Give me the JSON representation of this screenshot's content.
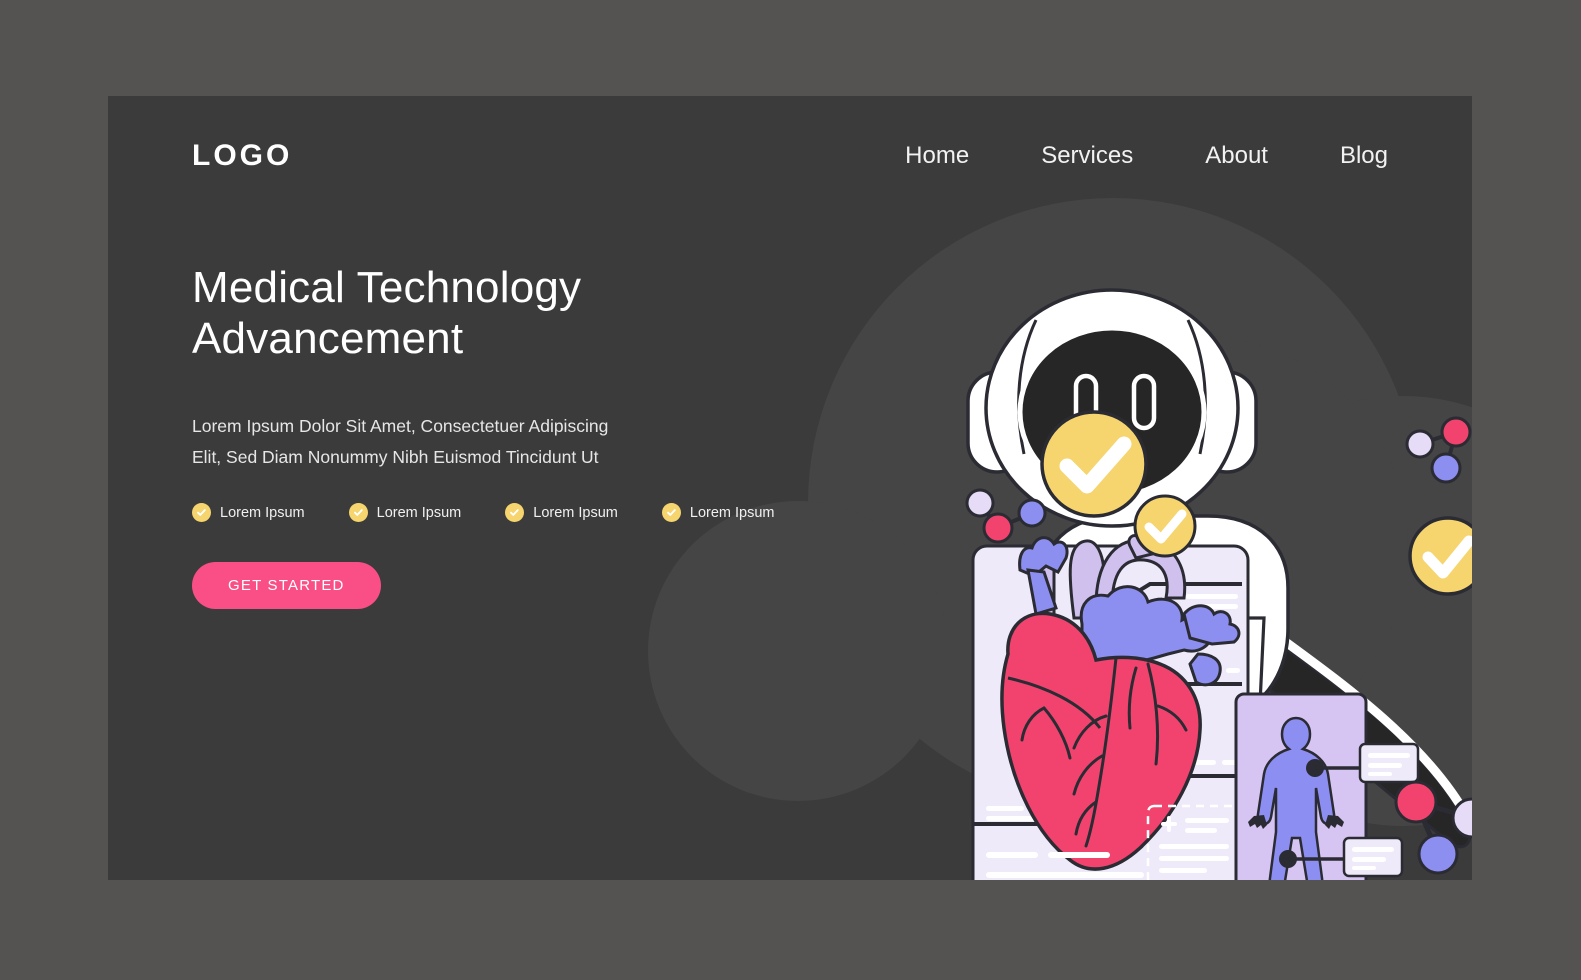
{
  "header": {
    "logo": "LOGO",
    "nav": [
      {
        "label": "Home"
      },
      {
        "label": "Services"
      },
      {
        "label": "About"
      },
      {
        "label": "Blog"
      }
    ]
  },
  "hero": {
    "headline_line1": "Medical Technology",
    "headline_line2": "Advancement",
    "subtext": "Lorem Ipsum Dolor Sit Amet, Consectetuer Adipiscing Elit, Sed Diam Nonummy Nibh Euismod Tincidunt Ut",
    "features": [
      {
        "label": "Lorem Ipsum",
        "icon": "check-circle-icon"
      },
      {
        "label": "Lorem Ipsum",
        "icon": "check-circle-icon"
      },
      {
        "label": "Lorem Ipsum",
        "icon": "check-circle-icon"
      },
      {
        "label": "Lorem Ipsum",
        "icon": "check-circle-icon"
      }
    ],
    "cta_label": "GET STARTED"
  },
  "illustration": {
    "name": "medical-technology-illustration",
    "elements": [
      "check-badge-icon",
      "check-badge-icon",
      "check-badge-icon",
      "molecule-icon",
      "molecule-icon",
      "molecule-icon",
      "robot-icon",
      "anatomical-heart-card",
      "human-body-scan-card"
    ]
  },
  "colors": {
    "page_background": "#3b3b3b",
    "outer_background": "#545352",
    "blob": "#454545",
    "accent_pink": "#f94f86",
    "accent_yellow": "#f6d46e",
    "heart_red": "#f2436f",
    "vessel_periwinkle": "#8c8ef0",
    "vessel_lavender": "#cfc0ee",
    "card_light": "#efeaf9",
    "card_purple": "#d6c5f2",
    "body_blue": "#8d8ef2",
    "text_white": "#ffffff",
    "outline_dark": "#2b2b33"
  }
}
